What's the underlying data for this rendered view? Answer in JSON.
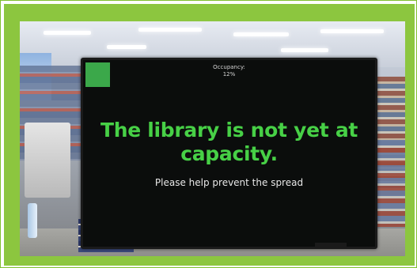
{
  "sign": {
    "occupancy_label": "Occupancy:",
    "occupancy_value": "12%",
    "headline": "The library is not yet at capacity.",
    "subline": "Please help prevent the spread",
    "status_color": "#3ba84a",
    "text_color": "#47d046"
  },
  "frame": {
    "border_color": "#8cc63f"
  }
}
